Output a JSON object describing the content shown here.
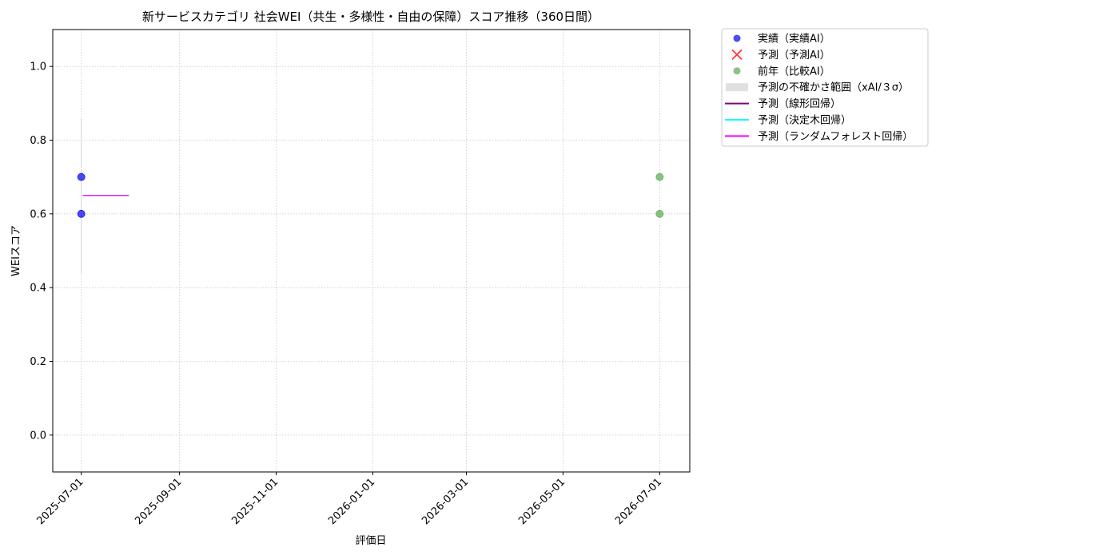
{
  "chart_data": {
    "type": "scatter",
    "title": "新サービスカテゴリ 社会WEI（共生・多様性・自由の保障）スコア推移（360日間）",
    "xlabel": "評価日",
    "ylabel": "WEIスコア",
    "xlim": [
      "2025-06-13",
      "2026-07-20"
    ],
    "ylim": [
      -0.1,
      1.1
    ],
    "x_ticks": [
      "2025-07-01",
      "2025-09-01",
      "2025-11-01",
      "2026-01-01",
      "2026-03-01",
      "2026-05-01",
      "2026-07-01"
    ],
    "y_ticks": [
      0.0,
      0.2,
      0.4,
      0.6,
      0.8,
      1.0
    ],
    "y_tick_labels": [
      "0.0",
      "0.2",
      "0.4",
      "0.6",
      "0.8",
      "1.0"
    ],
    "grid": true,
    "legend_position": "outside-top-right",
    "series": [
      {
        "name": "実績（実績AI）",
        "kind": "scatter",
        "marker": "circle",
        "color": "#0000ee",
        "points": [
          {
            "x": "2025-07-01",
            "y": 0.7
          },
          {
            "x": "2025-07-01",
            "y": 0.6
          }
        ]
      },
      {
        "name": "予測（予測AI）",
        "kind": "scatter",
        "marker": "x",
        "color": "#ff3333",
        "points": []
      },
      {
        "name": "前年（比較AI）",
        "kind": "scatter",
        "marker": "circle",
        "color": "#5aaa50",
        "points": [
          {
            "x": "2026-07-01",
            "y": 0.7
          },
          {
            "x": "2026-07-01",
            "y": 0.6
          }
        ]
      },
      {
        "name": "予測の不確かさ範囲（xAI/３σ）",
        "kind": "band",
        "color": "#d3d3d3",
        "x": [
          "2025-07-01",
          "2025-07-01"
        ],
        "lower": [
          0.44,
          0.44
        ],
        "upper": [
          0.86,
          0.86
        ]
      },
      {
        "name": "予測（線形回帰）",
        "kind": "line",
        "color": "#800080",
        "points": [
          {
            "x": "2025-07-02",
            "y": 0.65
          },
          {
            "x": "2025-07-31",
            "y": 0.65
          }
        ]
      },
      {
        "name": "予測（決定木回帰）",
        "kind": "line",
        "color": "#00ffff",
        "points": [
          {
            "x": "2025-07-02",
            "y": 0.65
          },
          {
            "x": "2025-07-31",
            "y": 0.65
          }
        ]
      },
      {
        "name": "予測（ランダムフォレスト回帰）",
        "kind": "line",
        "color": "#ff00ff",
        "points": [
          {
            "x": "2025-07-02",
            "y": 0.65
          },
          {
            "x": "2025-07-31",
            "y": 0.65
          }
        ]
      }
    ]
  }
}
